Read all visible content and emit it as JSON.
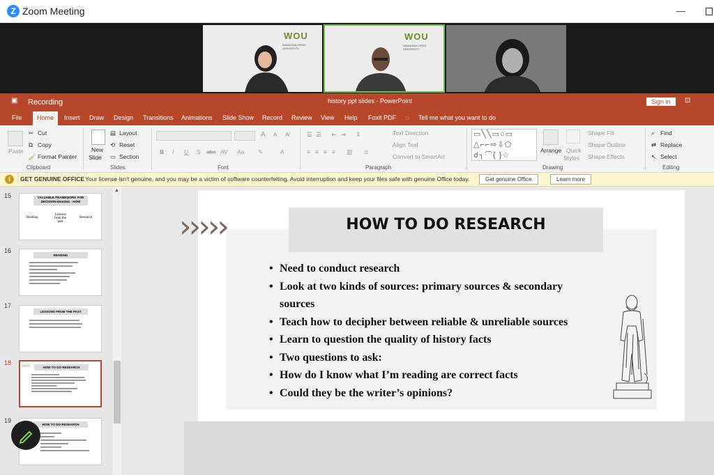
{
  "zoom": {
    "title": "Zoom Meeting",
    "logo_letter": "Z"
  },
  "videos": [
    {
      "logo": "WOU",
      "logo_sub": "WAWASAN OPEN UNIVERSITY"
    },
    {
      "logo": "WOU",
      "logo_sub": "WAWASAN OPEN UNIVERSITY"
    },
    {}
  ],
  "powerpoint": {
    "window_title": "history ppt slides  -  PowerPoint",
    "recording_label": "Recording",
    "sign_in": "Sign in",
    "tabs": [
      "File",
      "Home",
      "Insert",
      "Draw",
      "Design",
      "Transitions",
      "Animations",
      "Slide Show",
      "Record",
      "Review",
      "View",
      "Help",
      "Foxit PDF"
    ],
    "tell_me": "Tell me what you want to do",
    "ribbon": {
      "clipboard": {
        "paste": "Paste",
        "cut": "Cut",
        "copy": "Copy",
        "format_painter": "Format Painter",
        "label": "Clipboard"
      },
      "slides": {
        "new_slide_line1": "New",
        "new_slide_line2": "Slide",
        "layout": "Layout",
        "reset": "Reset",
        "section": "Section",
        "label": "Slides"
      },
      "font": {
        "label": "Font",
        "bold": "B",
        "italic": "I",
        "underline": "U",
        "shadow": "S",
        "strike": "abc",
        "spacing": "AV",
        "case": "Aa"
      },
      "paragraph": {
        "text_direction": "Text Direction",
        "align_text": "Align Text",
        "convert_smartart": "Convert to SmartArt",
        "label": "Paragraph"
      },
      "drawing": {
        "arrange": "Arrange",
        "quick_styles_line1": "Quick",
        "quick_styles_line2": "Styles",
        "shape_fill": "Shape Fill",
        "shape_outline": "Shape Outline",
        "shape_effects": "Shape Effects",
        "label": "Drawing"
      },
      "editing": {
        "find": "Find",
        "replace": "Replace",
        "select": "Select",
        "label": "Editing"
      }
    },
    "warning": {
      "title": "GET GENUINE OFFICE",
      "message": "Your license isn't genuine, and you may be a victim of software counterfeiting. Avoid interruption and keep your files safe with genuine Office today.",
      "button_genuine": "Get genuine Office",
      "button_learn": "Learn more"
    },
    "thumbnails": [
      {
        "number": "15",
        "title": "VALUABLE FRAMEWORK FOR DECISION-MAKING - HOW",
        "items": [
          "Reading",
          "Lessons from the past",
          "Research"
        ]
      },
      {
        "number": "16",
        "title": "READING"
      },
      {
        "number": "17",
        "title": "LESSONS FROM THE PAST"
      },
      {
        "number": "18",
        "title": "HOW TO DO RESEARCH",
        "selected": true
      },
      {
        "number": "19",
        "title": "HOW TO DO RESEARCH"
      }
    ],
    "slide": {
      "arrows": "›››››",
      "title": "HOW TO DO RESEARCH",
      "bullets": [
        "Need to conduct research",
        "Look at two kinds of sources: primary sources & secondary",
        "sources",
        "Teach how to decipher between reliable & unreliable sources",
        "Learn to question the quality of history facts",
        "Two questions to ask:",
        "How do I know what I’m reading are correct facts",
        "Could they be the writer’s opinions?"
      ],
      "bullet_char": "•"
    }
  }
}
